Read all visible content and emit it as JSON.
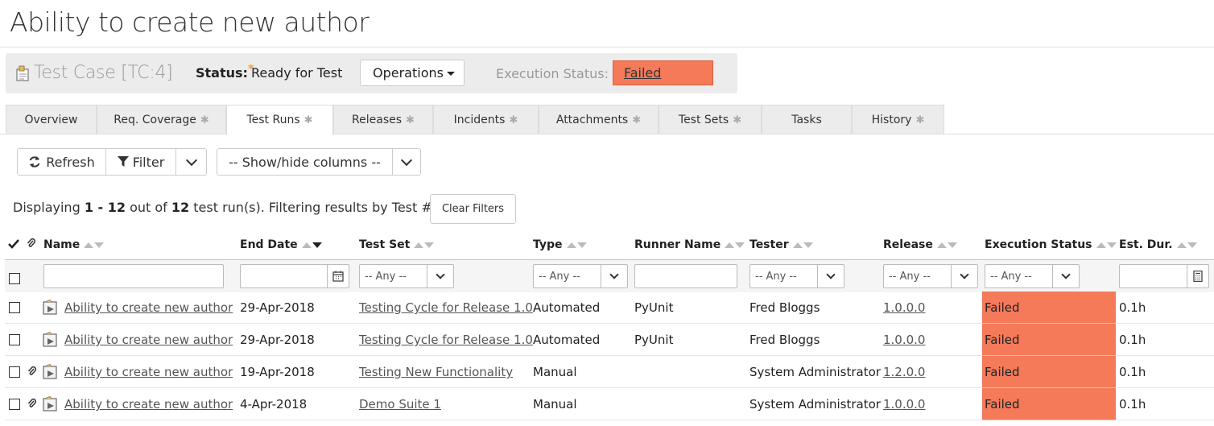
{
  "page": {
    "title": "Ability to create new author"
  },
  "header": {
    "test_case_label": "Test Case",
    "test_case_id": "[TC:4]",
    "status_label": "Status:",
    "status_star": "*",
    "status_value": "Ready for Test",
    "operations_label": "Operations",
    "execution_status_label": "Execution Status:",
    "execution_status_value": "Failed",
    "execution_status_color": "#f47a5a"
  },
  "tabs": [
    {
      "label": "Overview",
      "starred": false
    },
    {
      "label": "Req. Coverage",
      "starred": true
    },
    {
      "label": "Test Runs",
      "starred": true,
      "active": true
    },
    {
      "label": "Releases",
      "starred": true
    },
    {
      "label": "Incidents",
      "starred": true
    },
    {
      "label": "Attachments",
      "starred": true
    },
    {
      "label": "Test Sets",
      "starred": true
    },
    {
      "label": "Tasks",
      "starred": false
    },
    {
      "label": "History",
      "starred": true
    }
  ],
  "tab_star": "✱",
  "toolbar": {
    "refresh_label": "Refresh",
    "filter_label": "Filter",
    "columns_label": "-- Show/hide columns --",
    "clear_filters_label": "Clear Filters"
  },
  "summary": {
    "prefix": "Displaying",
    "range": "1 - 12",
    "middle": "out of",
    "total": "12",
    "suffix": "test run(s). Filtering results by Test #."
  },
  "columns": {
    "name": "Name",
    "end_date": "End Date",
    "test_set": "Test Set",
    "type": "Type",
    "runner_name": "Runner Name",
    "tester": "Tester",
    "release": "Release",
    "execution_status": "Execution Status",
    "est_dur": "Est. Dur."
  },
  "filters": {
    "any_label": "-- Any --"
  },
  "rows": [
    {
      "name": "Ability to create new author",
      "end_date": "29-Apr-2018",
      "test_set": "Testing Cycle for Release 1.0",
      "type": "Automated",
      "runner": "PyUnit",
      "tester": "Fred Bloggs",
      "release": "1.0.0.0",
      "status": "Failed",
      "est_dur": "0.1h",
      "has_attachment": false
    },
    {
      "name": "Ability to create new author",
      "end_date": "29-Apr-2018",
      "test_set": "Testing Cycle for Release 1.0",
      "type": "Automated",
      "runner": "PyUnit",
      "tester": "Fred Bloggs",
      "release": "1.0.0.0",
      "status": "Failed",
      "est_dur": "0.1h",
      "has_attachment": false
    },
    {
      "name": "Ability to create new author",
      "end_date": "19-Apr-2018",
      "test_set": "Testing New Functionality",
      "type": "Manual",
      "runner": "",
      "tester": "System Administrator",
      "release": "1.2.0.0",
      "status": "Failed",
      "est_dur": "0.1h",
      "has_attachment": true
    },
    {
      "name": "Ability to create new author",
      "end_date": "4-Apr-2018",
      "test_set": "Demo Suite 1",
      "type": "Manual",
      "runner": "",
      "tester": "System Administrator",
      "release": "1.0.0.0",
      "status": "Failed",
      "est_dur": "0.1h",
      "has_attachment": true
    }
  ]
}
